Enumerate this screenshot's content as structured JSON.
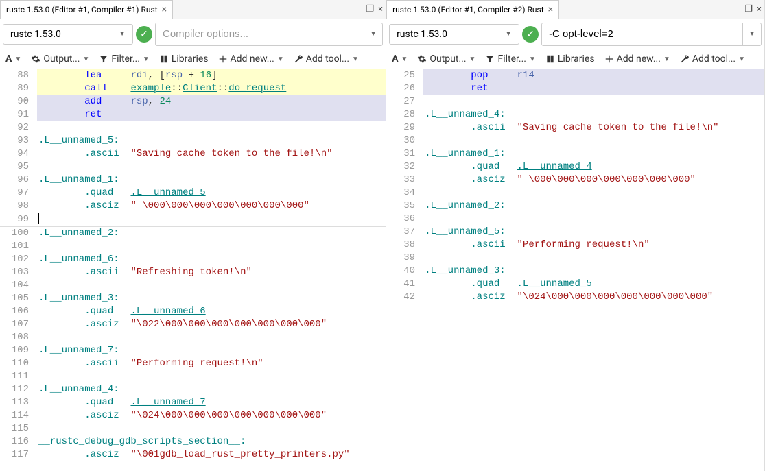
{
  "panes": [
    {
      "tab_title": "rustc 1.53.0 (Editor #1, Compiler #1) Rust",
      "compiler": "rustc 1.53.0",
      "compiler_options_placeholder": "Compiler options...",
      "compiler_options_value": "",
      "toolbar": {
        "output": "Output...",
        "filter": "Filter...",
        "libraries": "Libraries",
        "add_new": "Add new...",
        "add_tool": "Add tool..."
      },
      "code": [
        {
          "n": 88,
          "hl": "yellow",
          "tokens": [
            {
              "t": "indent",
              "v": "        "
            },
            {
              "t": "mnemonic",
              "v": "lea"
            },
            {
              "t": "pad",
              "v": "     "
            },
            {
              "t": "register",
              "v": "rdi"
            },
            {
              "t": "punct",
              "v": ", ["
            },
            {
              "t": "register",
              "v": "rsp"
            },
            {
              "t": "punct",
              "v": " + "
            },
            {
              "t": "number",
              "v": "16"
            },
            {
              "t": "punct",
              "v": "]"
            }
          ]
        },
        {
          "n": 89,
          "hl": "yellow",
          "tokens": [
            {
              "t": "indent",
              "v": "        "
            },
            {
              "t": "mnemonic",
              "v": "call"
            },
            {
              "t": "pad",
              "v": "    "
            },
            {
              "t": "link",
              "v": "example"
            },
            {
              "t": "ns",
              "v": "::"
            },
            {
              "t": "link",
              "v": "Client"
            },
            {
              "t": "ns",
              "v": "::"
            },
            {
              "t": "link",
              "v": "do_request"
            }
          ]
        },
        {
          "n": 90,
          "hl": "blue",
          "tokens": [
            {
              "t": "indent",
              "v": "        "
            },
            {
              "t": "mnemonic",
              "v": "add"
            },
            {
              "t": "pad",
              "v": "     "
            },
            {
              "t": "register",
              "v": "rsp"
            },
            {
              "t": "punct",
              "v": ", "
            },
            {
              "t": "number",
              "v": "24"
            }
          ]
        },
        {
          "n": 91,
          "hl": "blue",
          "tokens": [
            {
              "t": "indent",
              "v": "        "
            },
            {
              "t": "mnemonic",
              "v": "ret"
            }
          ]
        },
        {
          "n": 92,
          "tokens": []
        },
        {
          "n": 93,
          "tokens": [
            {
              "t": "label",
              "v": ".L__unnamed_5:"
            }
          ]
        },
        {
          "n": 94,
          "tokens": [
            {
              "t": "indent",
              "v": "        "
            },
            {
              "t": "directive",
              "v": ".ascii"
            },
            {
              "t": "pad",
              "v": "  "
            },
            {
              "t": "string",
              "v": "\"Saving cache token to the file!\\n\""
            }
          ]
        },
        {
          "n": 95,
          "tokens": []
        },
        {
          "n": 96,
          "tokens": [
            {
              "t": "label",
              "v": ".L__unnamed_1:"
            }
          ]
        },
        {
          "n": 97,
          "tokens": [
            {
              "t": "indent",
              "v": "        "
            },
            {
              "t": "directive",
              "v": ".quad"
            },
            {
              "t": "pad",
              "v": "   "
            },
            {
              "t": "link",
              "v": ".L__unnamed_5"
            }
          ]
        },
        {
          "n": 98,
          "tokens": [
            {
              "t": "indent",
              "v": "        "
            },
            {
              "t": "directive",
              "v": ".asciz"
            },
            {
              "t": "pad",
              "v": "  "
            },
            {
              "t": "string",
              "v": "\" \\000\\000\\000\\000\\000\\000\\000\""
            }
          ]
        },
        {
          "n": 99,
          "cursor": true,
          "tokens": []
        },
        {
          "n": 100,
          "tokens": [
            {
              "t": "label",
              "v": ".L__unnamed_2:"
            }
          ]
        },
        {
          "n": 101,
          "tokens": []
        },
        {
          "n": 102,
          "tokens": [
            {
              "t": "label",
              "v": ".L__unnamed_6:"
            }
          ]
        },
        {
          "n": 103,
          "tokens": [
            {
              "t": "indent",
              "v": "        "
            },
            {
              "t": "directive",
              "v": ".ascii"
            },
            {
              "t": "pad",
              "v": "  "
            },
            {
              "t": "string",
              "v": "\"Refreshing token!\\n\""
            }
          ]
        },
        {
          "n": 104,
          "tokens": []
        },
        {
          "n": 105,
          "tokens": [
            {
              "t": "label",
              "v": ".L__unnamed_3:"
            }
          ]
        },
        {
          "n": 106,
          "tokens": [
            {
              "t": "indent",
              "v": "        "
            },
            {
              "t": "directive",
              "v": ".quad"
            },
            {
              "t": "pad",
              "v": "   "
            },
            {
              "t": "link",
              "v": ".L__unnamed_6"
            }
          ]
        },
        {
          "n": 107,
          "tokens": [
            {
              "t": "indent",
              "v": "        "
            },
            {
              "t": "directive",
              "v": ".asciz"
            },
            {
              "t": "pad",
              "v": "  "
            },
            {
              "t": "string",
              "v": "\"\\022\\000\\000\\000\\000\\000\\000\\000\""
            }
          ]
        },
        {
          "n": 108,
          "tokens": []
        },
        {
          "n": 109,
          "tokens": [
            {
              "t": "label",
              "v": ".L__unnamed_7:"
            }
          ]
        },
        {
          "n": 110,
          "tokens": [
            {
              "t": "indent",
              "v": "        "
            },
            {
              "t": "directive",
              "v": ".ascii"
            },
            {
              "t": "pad",
              "v": "  "
            },
            {
              "t": "string",
              "v": "\"Performing request!\\n\""
            }
          ]
        },
        {
          "n": 111,
          "tokens": []
        },
        {
          "n": 112,
          "tokens": [
            {
              "t": "label",
              "v": ".L__unnamed_4:"
            }
          ]
        },
        {
          "n": 113,
          "tokens": [
            {
              "t": "indent",
              "v": "        "
            },
            {
              "t": "directive",
              "v": ".quad"
            },
            {
              "t": "pad",
              "v": "   "
            },
            {
              "t": "link",
              "v": ".L__unnamed_7"
            }
          ]
        },
        {
          "n": 114,
          "tokens": [
            {
              "t": "indent",
              "v": "        "
            },
            {
              "t": "directive",
              "v": ".asciz"
            },
            {
              "t": "pad",
              "v": "  "
            },
            {
              "t": "string",
              "v": "\"\\024\\000\\000\\000\\000\\000\\000\\000\""
            }
          ]
        },
        {
          "n": 115,
          "tokens": []
        },
        {
          "n": 116,
          "tokens": [
            {
              "t": "label",
              "v": "__rustc_debug_gdb_scripts_section__:"
            }
          ]
        },
        {
          "n": 117,
          "tokens": [
            {
              "t": "indent",
              "v": "        "
            },
            {
              "t": "directive",
              "v": ".asciz"
            },
            {
              "t": "pad",
              "v": "  "
            },
            {
              "t": "string",
              "v": "\"\\001gdb_load_rust_pretty_printers.py\""
            }
          ]
        }
      ]
    },
    {
      "tab_title": "rustc 1.53.0 (Editor #1, Compiler #2) Rust",
      "compiler": "rustc 1.53.0",
      "compiler_options_placeholder": "Compiler options...",
      "compiler_options_value": "-C opt-level=2",
      "toolbar": {
        "output": "Output...",
        "filter": "Filter...",
        "libraries": "Libraries",
        "add_new": "Add new...",
        "add_tool": "Add tool..."
      },
      "code": [
        {
          "n": 25,
          "hl": "blue",
          "tokens": [
            {
              "t": "indent",
              "v": "        "
            },
            {
              "t": "mnemonic",
              "v": "pop"
            },
            {
              "t": "pad",
              "v": "     "
            },
            {
              "t": "register",
              "v": "r14"
            }
          ]
        },
        {
          "n": 26,
          "hl": "blue",
          "tokens": [
            {
              "t": "indent",
              "v": "        "
            },
            {
              "t": "mnemonic",
              "v": "ret"
            }
          ]
        },
        {
          "n": 27,
          "tokens": []
        },
        {
          "n": 28,
          "tokens": [
            {
              "t": "label",
              "v": ".L__unnamed_4:"
            }
          ]
        },
        {
          "n": 29,
          "tokens": [
            {
              "t": "indent",
              "v": "        "
            },
            {
              "t": "directive",
              "v": ".ascii"
            },
            {
              "t": "pad",
              "v": "  "
            },
            {
              "t": "string",
              "v": "\"Saving cache token to the file!\\n\""
            }
          ]
        },
        {
          "n": 30,
          "tokens": []
        },
        {
          "n": 31,
          "tokens": [
            {
              "t": "label",
              "v": ".L__unnamed_1:"
            }
          ]
        },
        {
          "n": 32,
          "tokens": [
            {
              "t": "indent",
              "v": "        "
            },
            {
              "t": "directive",
              "v": ".quad"
            },
            {
              "t": "pad",
              "v": "   "
            },
            {
              "t": "link",
              "v": ".L__unnamed_4"
            }
          ]
        },
        {
          "n": 33,
          "tokens": [
            {
              "t": "indent",
              "v": "        "
            },
            {
              "t": "directive",
              "v": ".asciz"
            },
            {
              "t": "pad",
              "v": "  "
            },
            {
              "t": "string",
              "v": "\" \\000\\000\\000\\000\\000\\000\\000\""
            }
          ]
        },
        {
          "n": 34,
          "tokens": []
        },
        {
          "n": 35,
          "tokens": [
            {
              "t": "label",
              "v": ".L__unnamed_2:"
            }
          ]
        },
        {
          "n": 36,
          "tokens": []
        },
        {
          "n": 37,
          "tokens": [
            {
              "t": "label",
              "v": ".L__unnamed_5:"
            }
          ]
        },
        {
          "n": 38,
          "tokens": [
            {
              "t": "indent",
              "v": "        "
            },
            {
              "t": "directive",
              "v": ".ascii"
            },
            {
              "t": "pad",
              "v": "  "
            },
            {
              "t": "string",
              "v": "\"Performing request!\\n\""
            }
          ]
        },
        {
          "n": 39,
          "tokens": []
        },
        {
          "n": 40,
          "tokens": [
            {
              "t": "label",
              "v": ".L__unnamed_3:"
            }
          ]
        },
        {
          "n": 41,
          "tokens": [
            {
              "t": "indent",
              "v": "        "
            },
            {
              "t": "directive",
              "v": ".quad"
            },
            {
              "t": "pad",
              "v": "   "
            },
            {
              "t": "link",
              "v": ".L__unnamed_5"
            }
          ]
        },
        {
          "n": 42,
          "tokens": [
            {
              "t": "indent",
              "v": "        "
            },
            {
              "t": "directive",
              "v": ".asciz"
            },
            {
              "t": "pad",
              "v": "  "
            },
            {
              "t": "string",
              "v": "\"\\024\\000\\000\\000\\000\\000\\000\\000\""
            }
          ]
        }
      ]
    }
  ]
}
